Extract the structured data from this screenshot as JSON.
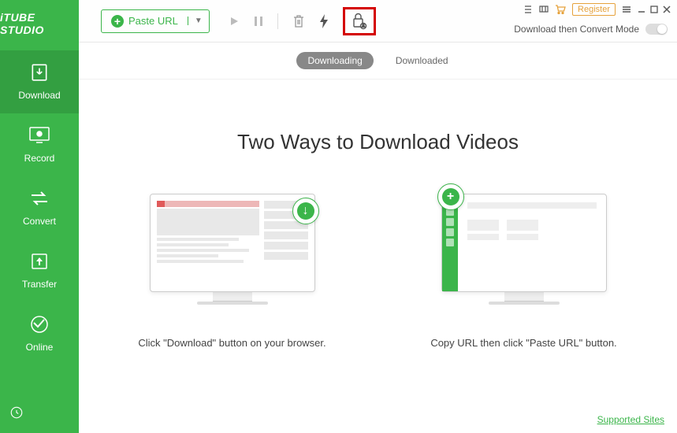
{
  "app_name": "iTUBE STUDIO",
  "sidebar": {
    "items": [
      {
        "label": "Download"
      },
      {
        "label": "Record"
      },
      {
        "label": "Convert"
      },
      {
        "label": "Transfer"
      },
      {
        "label": "Online"
      }
    ]
  },
  "toolbar": {
    "paste_label": "Paste URL",
    "register_label": "Register",
    "mode_label": "Download then Convert Mode"
  },
  "tabs": {
    "downloading": "Downloading",
    "downloaded": "Downloaded"
  },
  "content": {
    "headline": "Two Ways to Download Videos",
    "caption_left": "Click \"Download\" button on your browser.",
    "caption_right": "Copy URL then click \"Paste URL\" button."
  },
  "footer": {
    "supported_sites": "Supported Sites"
  }
}
